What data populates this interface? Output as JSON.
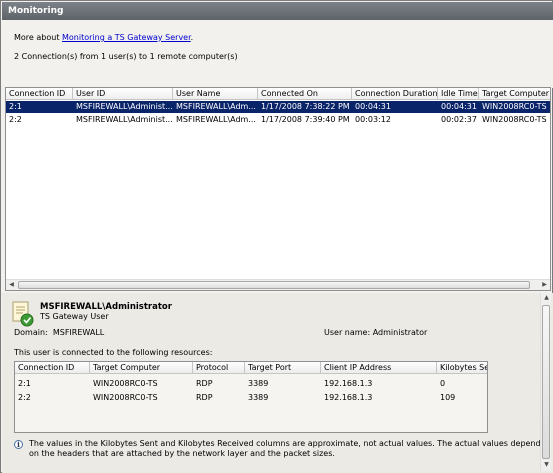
{
  "title": "Monitoring",
  "info": {
    "more_about_prefix": "More about ",
    "more_about_link": "Monitoring a TS Gateway Server",
    "more_about_suffix": ".",
    "summary": "2 Connection(s) from 1 user(s) to 1 remote computer(s)"
  },
  "connections": {
    "columns": [
      "Connection ID",
      "User ID",
      "User Name",
      "Connected On",
      "Connection Duration",
      "Idle Time",
      "Target Computer"
    ],
    "rows": [
      [
        "2:1",
        "MSFIREWALL\\Administ...",
        "MSFIREWALL\\Adm...",
        "1/17/2008 7:38:22 PM",
        "00:04:31",
        "00:04:31",
        "WIN2008RC0-TS"
      ],
      [
        "2:2",
        "MSFIREWALL\\Administ...",
        "MSFIREWALL\\Adm...",
        "1/17/2008 7:39:40 PM",
        "00:03:12",
        "00:02:37",
        "WIN2008RC0-TS"
      ]
    ],
    "selected_row": 0
  },
  "details": {
    "user_name": "MSFIREWALL\\Administrator",
    "user_type": "TS Gateway User",
    "domain_label": "Domain:",
    "domain_value": "MSFIREWALL",
    "username_label": "User name:",
    "username_value": "Administrator",
    "resources_text": "This user is connected to the following resources:",
    "columns": [
      "Connection ID",
      "Target Computer",
      "Protocol",
      "Target Port",
      "Client IP Address",
      "Kilobytes Sen"
    ],
    "rows": [
      [
        "2:1",
        "WIN2008RC0-TS",
        "RDP",
        "3389",
        "192.168.1.3",
        "0"
      ],
      [
        "2:2",
        "WIN2008RC0-TS",
        "RDP",
        "3389",
        "192.168.1.3",
        "109"
      ]
    ],
    "note": "The values in the Kilobytes Sent and Kilobytes Received columns are approximate, not actual values. The actual values depend on the headers that are attached by the network layer and the packet sizes."
  },
  "icons": {
    "info": "info-icon",
    "user": "user-certificate-icon",
    "scroll_left": "scroll-left-icon",
    "scroll_right": "scroll-right-icon",
    "scroll_up": "scroll-up-icon",
    "scroll_down": "scroll-down-icon"
  },
  "colors": {
    "title_bar": "#6a6f74",
    "selection": "#0a246a",
    "link": "#0000cc"
  }
}
